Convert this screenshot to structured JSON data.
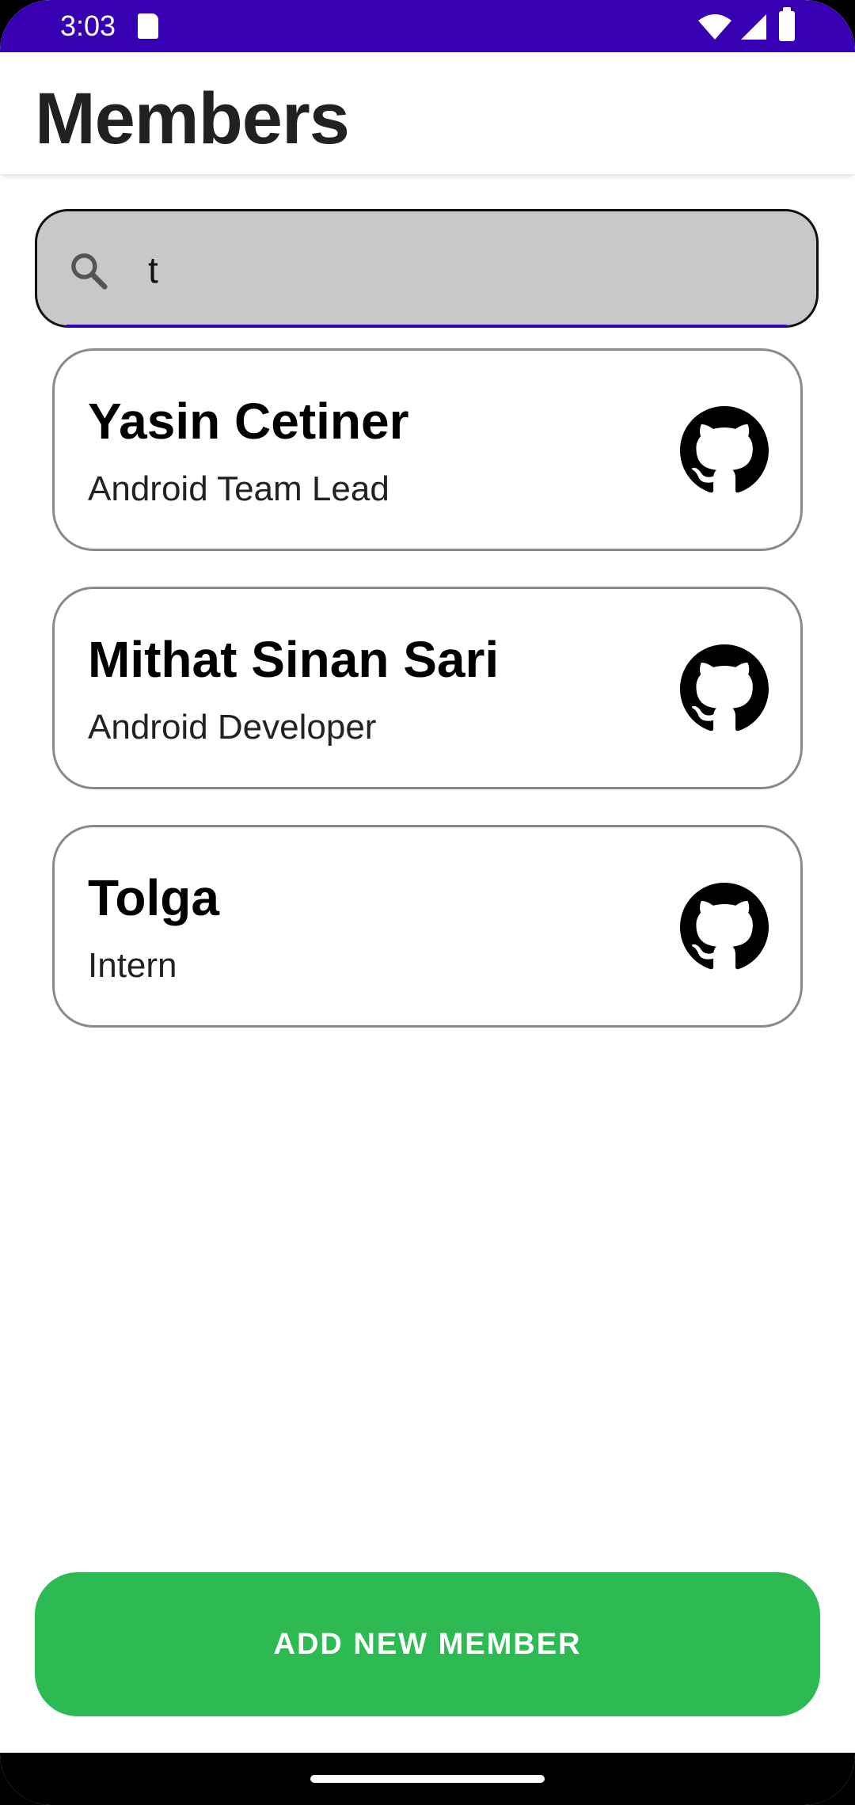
{
  "status_bar": {
    "time": "3:03",
    "icons": [
      "sd-card-icon",
      "wifi-icon",
      "signal-icon",
      "battery-icon"
    ],
    "background_color": "#3700b3"
  },
  "app_bar": {
    "title": "Members"
  },
  "search": {
    "value": "t",
    "icon": "search-icon"
  },
  "members": [
    {
      "name": "Yasin Cetiner",
      "role": "Android Team Lead",
      "icon": "github-icon"
    },
    {
      "name": "Mithat Sinan Sari",
      "role": "Android Developer",
      "icon": "github-icon"
    },
    {
      "name": "Tolga",
      "role": "Intern",
      "icon": "github-icon"
    }
  ],
  "actions": {
    "add_member_label": "ADD NEW MEMBER",
    "button_color": "#2dba52"
  }
}
